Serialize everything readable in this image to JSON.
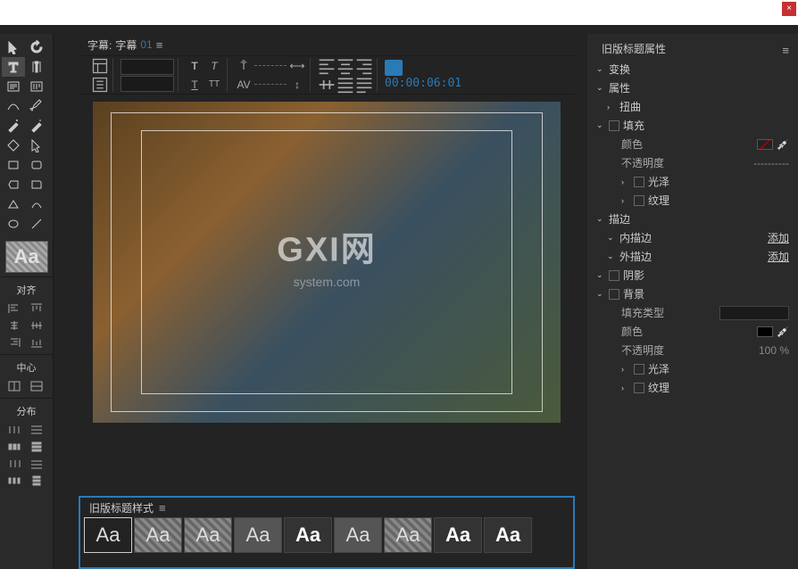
{
  "topbar": {
    "close": "×"
  },
  "title": {
    "prefix": "字幕:",
    "name": "字幕",
    "num": "01",
    "menu": "≡"
  },
  "toolbar": {
    "timecode": "00:00:06:01"
  },
  "left": {
    "align_title": "对齐",
    "center_title": "中心",
    "distrib_title": "分布",
    "aa": "Aa"
  },
  "watermark": {
    "main": "GXI网",
    "sub": "system.com"
  },
  "styles": {
    "title": "旧版标题样式",
    "menu": "≡",
    "items": [
      "Aa",
      "Aa",
      "Aa",
      "Aa",
      "Aa",
      "Aa",
      "Aa",
      "Aa",
      "Aa"
    ]
  },
  "props": {
    "title": "旧版标题属性",
    "menu": "≡",
    "transform": "变换",
    "properties": "属性",
    "distort": "扭曲",
    "fill": "填充",
    "color": "颜色",
    "opacity": "不透明度",
    "opacity_dash": "----------",
    "sheen": "光泽",
    "texture": "纹理",
    "stroke": "描边",
    "inner_stroke": "内描边",
    "outer_stroke": "外描边",
    "add": "添加",
    "shadow": "阴影",
    "background": "背景",
    "fill_type": "填充类型",
    "bg_opacity_val": "100 %"
  }
}
